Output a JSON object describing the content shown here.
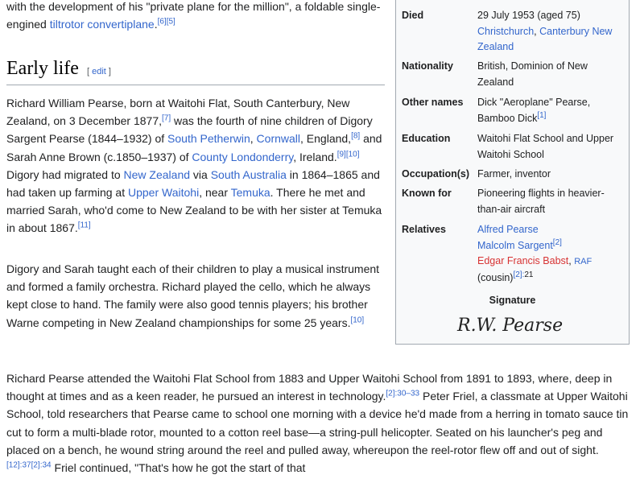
{
  "intro": {
    "text1": "with the development of his \"private plane for the million\", a foldable single-engined ",
    "link1": "tiltrotor",
    "space": " ",
    "link2": "convertiplane",
    "text2": ".",
    "refs": "[6][5]"
  },
  "heading": {
    "title": "Early life",
    "edit_open": "[ ",
    "edit_label": "edit",
    "edit_close": " ]"
  },
  "para1": {
    "t1": "Richard William Pearse, born at Waitohi Flat, South Canterbury, New Zealand, on 3 December 1877,",
    "r1": "[7]",
    "t2": " was the fourth of nine children of Digory Sargent Pearse (1844–1932) of ",
    "l1": "South Petherwin",
    "t3": ", ",
    "l2": "Cornwall",
    "t4": ", England,",
    "r2": "[8]",
    "t5": " and Sarah Anne Brown (c.1850–1937) of ",
    "l3": "County Londonderry",
    "t6": ", Ireland.",
    "r3": "[9][10]",
    "t7": " Digory had migrated to ",
    "l4": "New Zealand",
    "t8": " via ",
    "l5": "South Australia",
    "t9": " in 1864–1865 and had taken up farming at ",
    "l6": "Upper Waitohi",
    "t10": ", near ",
    "l7": "Temuka",
    "t11": ". There he met and married Sarah, who'd come to New Zealand to be with her sister at Temuka in about 1867.",
    "r4": "[11]"
  },
  "para2": {
    "t1": "Digory and Sarah taught each of their children to play a musical instrument and formed a family orchestra. Richard played the cello, which he always kept close to hand. The family were also good tennis players; his brother Warne competing in New Zealand championships for some 25 years.",
    "r1": "[10]"
  },
  "para3": {
    "t1": "Richard Pearse attended the Waitohi Flat School from 1883 and Upper Waitohi School from 1891 to 1893, where, deep in thought at times and as a keen reader, he pursued an interest in technology.",
    "r1": "[2]:30–33",
    "t2": " Peter Friel, a classmate at Upper Waitohi School, told researchers that Pearse came to school one morning with a device he'd made from a herring in tomato sauce tin cut to form a multi-blade rotor, mounted to a cotton reel base—a string-pull helicopter. Seated on his launcher's peg and placed on a bench, he wound string around the reel and pulled away, whereupon the reel-rotor flew off and out of sight.",
    "r2": "[12]:37",
    "r3": "[2]:34",
    "t3": " Friel continued, \"That's how he got the start of that"
  },
  "infobox": {
    "died": {
      "label": "Died",
      "text": "29 July 1953 (aged 75)",
      "link1": "Christchurch",
      "sep": ", ",
      "link2": "Canterbury",
      "link3": "New Zealand"
    },
    "nationality": {
      "label": "Nationality",
      "value": "British, Dominion of New Zealand"
    },
    "other_names": {
      "label": "Other names",
      "value": "Dick \"Aeroplane\" Pearse, Bamboo Dick",
      "ref": "[1]"
    },
    "education": {
      "label": "Education",
      "value": "Waitohi Flat School and Upper Waitohi School"
    },
    "occupation": {
      "label": "Occupation(s)",
      "value": "Farmer, inventor"
    },
    "known_for": {
      "label": "Known for",
      "value": "Pioneering flights in heavier-than-air aircraft"
    },
    "relatives": {
      "label": "Relatives",
      "r1": "Alfred Pearse",
      "r2": "Malcolm Sargent",
      "r2_ref": "[2]",
      "r3": "Edgar Francis Babst",
      "r3_suffix": "RAF",
      "r3_note": "(cousin)",
      "r3_ref": "[2]:",
      "r3_ref_page": "21"
    },
    "signature_label": "Signature",
    "signature_text": "R.W. Pearse"
  }
}
